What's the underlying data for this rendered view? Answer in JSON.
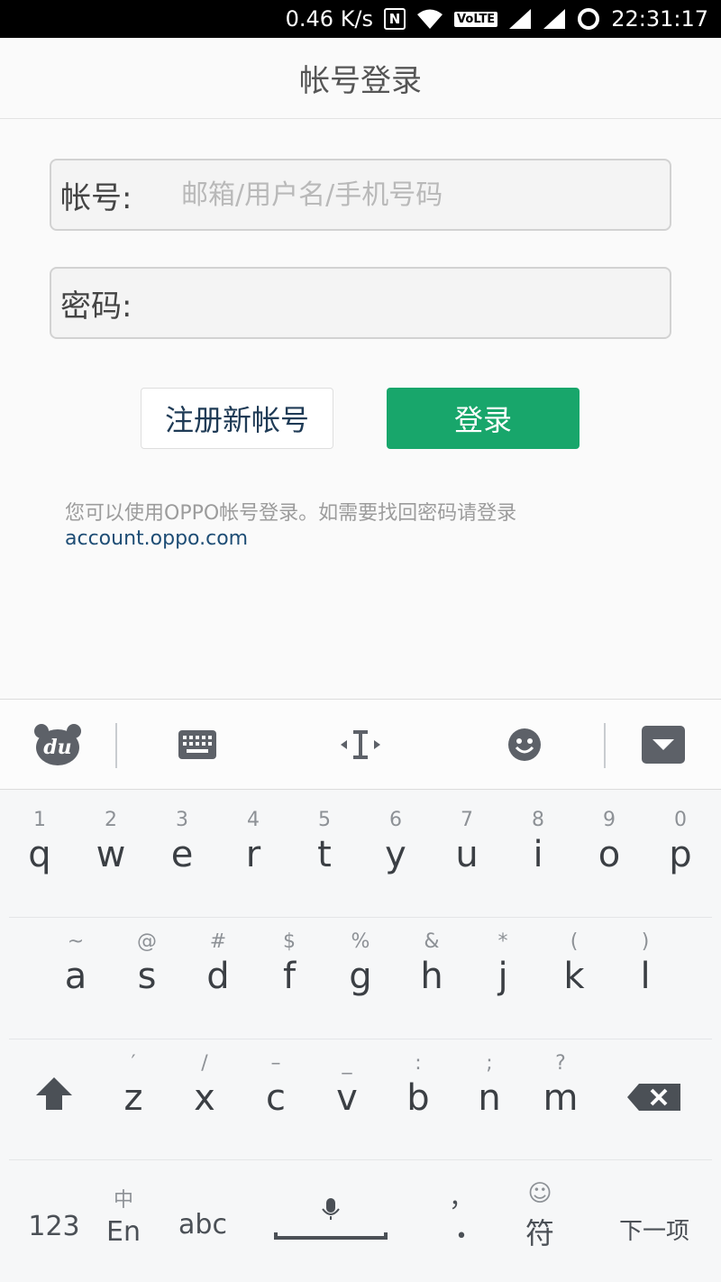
{
  "status": {
    "speed": "0.46 K/s",
    "nfc": "N",
    "lte": "VoLTE",
    "time": "22:31:17"
  },
  "title": "帐号登录",
  "form": {
    "account_label": "帐号:",
    "account_placeholder": "邮箱/用户名/手机号码",
    "password_label": "密码:",
    "password_value": ""
  },
  "buttons": {
    "register": "注册新帐号",
    "login": "登录"
  },
  "hint": {
    "text": "您可以使用OPPO帐号登录。如需要找回密码请登录",
    "link": "account.oppo.com"
  },
  "keyboard": {
    "toolbar": [
      "du-logo-icon",
      "keyboard-icon",
      "cursor-icon",
      "emoji-icon",
      "hide-keyboard-icon"
    ],
    "logo_text": "du",
    "row1": [
      {
        "num": "1",
        "ch": "q"
      },
      {
        "num": "2",
        "ch": "w"
      },
      {
        "num": "3",
        "ch": "e"
      },
      {
        "num": "4",
        "ch": "r"
      },
      {
        "num": "5",
        "ch": "t"
      },
      {
        "num": "6",
        "ch": "y"
      },
      {
        "num": "7",
        "ch": "u"
      },
      {
        "num": "8",
        "ch": "i"
      },
      {
        "num": "9",
        "ch": "o"
      },
      {
        "num": "0",
        "ch": "p"
      }
    ],
    "row2": [
      {
        "num": "~",
        "ch": "a"
      },
      {
        "num": "@",
        "ch": "s"
      },
      {
        "num": "#",
        "ch": "d"
      },
      {
        "num": "$",
        "ch": "f"
      },
      {
        "num": "%",
        "ch": "g"
      },
      {
        "num": "&",
        "ch": "h"
      },
      {
        "num": "*",
        "ch": "j"
      },
      {
        "num": "(",
        "ch": "k"
      },
      {
        "num": ")",
        "ch": "l"
      }
    ],
    "row3": [
      {
        "num": "′",
        "ch": "z"
      },
      {
        "num": "/",
        "ch": "x"
      },
      {
        "num": "–",
        "ch": "c"
      },
      {
        "num": "_",
        "ch": "v"
      },
      {
        "num": ":",
        "ch": "b"
      },
      {
        "num": ";",
        "ch": "n"
      },
      {
        "num": "?",
        "ch": "m"
      }
    ],
    "bottom": {
      "num_key": "123",
      "lang_top": "中",
      "lang_bottom": "En",
      "abc": "abc",
      "comma": "，",
      "period": "•",
      "symbol_top": "☺",
      "symbol": "符",
      "next": "下一项"
    }
  }
}
